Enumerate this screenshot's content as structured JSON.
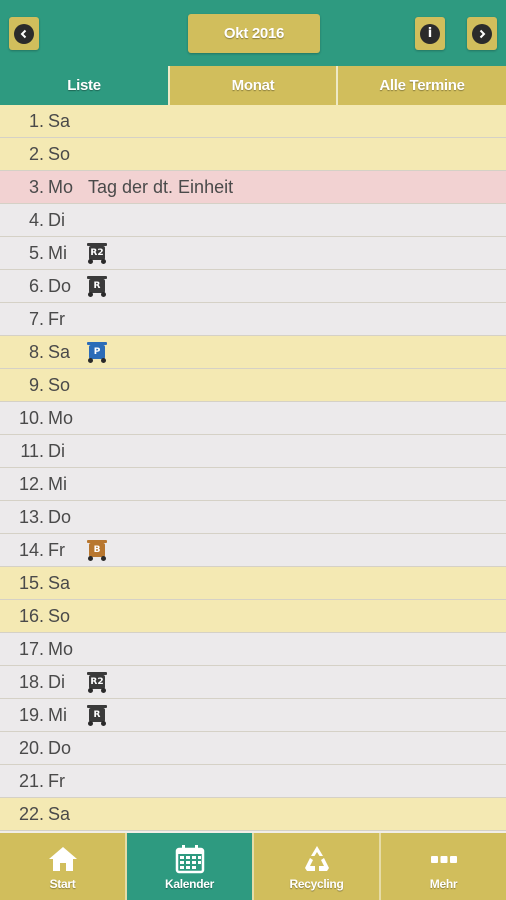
{
  "header": {
    "month_label": "Okt 2016",
    "prev_icon": "chevron-left-icon",
    "info_icon": "info-icon",
    "info_glyph": "i",
    "next_icon": "chevron-right-icon"
  },
  "tabs": [
    {
      "label": "Liste",
      "active": true
    },
    {
      "label": "Monat",
      "active": false
    },
    {
      "label": "Alle Termine",
      "active": false
    }
  ],
  "days": [
    {
      "num": "1.",
      "name": "Sa",
      "type": "weekend",
      "event": "",
      "bin": ""
    },
    {
      "num": "2.",
      "name": "So",
      "type": "weekend",
      "event": "",
      "bin": ""
    },
    {
      "num": "3.",
      "name": "Mo",
      "type": "holiday",
      "event": "Tag der dt. Einheit",
      "bin": ""
    },
    {
      "num": "4.",
      "name": "Di",
      "type": "weekday",
      "event": "",
      "bin": ""
    },
    {
      "num": "5.",
      "name": "Mi",
      "type": "weekday",
      "event": "",
      "bin": "R2"
    },
    {
      "num": "6.",
      "name": "Do",
      "type": "weekday",
      "event": "",
      "bin": "R"
    },
    {
      "num": "7.",
      "name": "Fr",
      "type": "weekday",
      "event": "",
      "bin": ""
    },
    {
      "num": "8.",
      "name": "Sa",
      "type": "weekend",
      "event": "",
      "bin": "P"
    },
    {
      "num": "9.",
      "name": "So",
      "type": "weekend",
      "event": "",
      "bin": ""
    },
    {
      "num": "10.",
      "name": "Mo",
      "type": "weekday",
      "event": "",
      "bin": ""
    },
    {
      "num": "11.",
      "name": "Di",
      "type": "weekday",
      "event": "",
      "bin": ""
    },
    {
      "num": "12.",
      "name": "Mi",
      "type": "weekday",
      "event": "",
      "bin": ""
    },
    {
      "num": "13.",
      "name": "Do",
      "type": "weekday",
      "event": "",
      "bin": ""
    },
    {
      "num": "14.",
      "name": "Fr",
      "type": "weekday",
      "event": "",
      "bin": "B"
    },
    {
      "num": "15.",
      "name": "Sa",
      "type": "weekend",
      "event": "",
      "bin": ""
    },
    {
      "num": "16.",
      "name": "So",
      "type": "weekend",
      "event": "",
      "bin": ""
    },
    {
      "num": "17.",
      "name": "Mo",
      "type": "weekday",
      "event": "",
      "bin": ""
    },
    {
      "num": "18.",
      "name": "Di",
      "type": "weekday",
      "event": "",
      "bin": "R2"
    },
    {
      "num": "19.",
      "name": "Mi",
      "type": "weekday",
      "event": "",
      "bin": "R"
    },
    {
      "num": "20.",
      "name": "Do",
      "type": "weekday",
      "event": "",
      "bin": ""
    },
    {
      "num": "21.",
      "name": "Fr",
      "type": "weekday",
      "event": "",
      "bin": ""
    },
    {
      "num": "22.",
      "name": "Sa",
      "type": "weekend",
      "event": "",
      "bin": ""
    }
  ],
  "bin_colors": {
    "R2": "#3a3a3a",
    "R": "#3a3a3a",
    "P": "#2b6cb8",
    "B": "#b8772f"
  },
  "footer": [
    {
      "label": "Start",
      "icon": "home-icon",
      "active": false
    },
    {
      "label": "Kalender",
      "icon": "calendar-icon",
      "active": true
    },
    {
      "label": "Recycling",
      "icon": "recycle-icon",
      "active": false
    },
    {
      "label": "Mehr",
      "icon": "more-icon",
      "active": false
    }
  ],
  "colors": {
    "primary": "#2e9a80",
    "gold": "#d1be5c",
    "weekend": "#f4e9b3",
    "holiday": "#f2d2d2",
    "weekday": "#eceaeb"
  }
}
